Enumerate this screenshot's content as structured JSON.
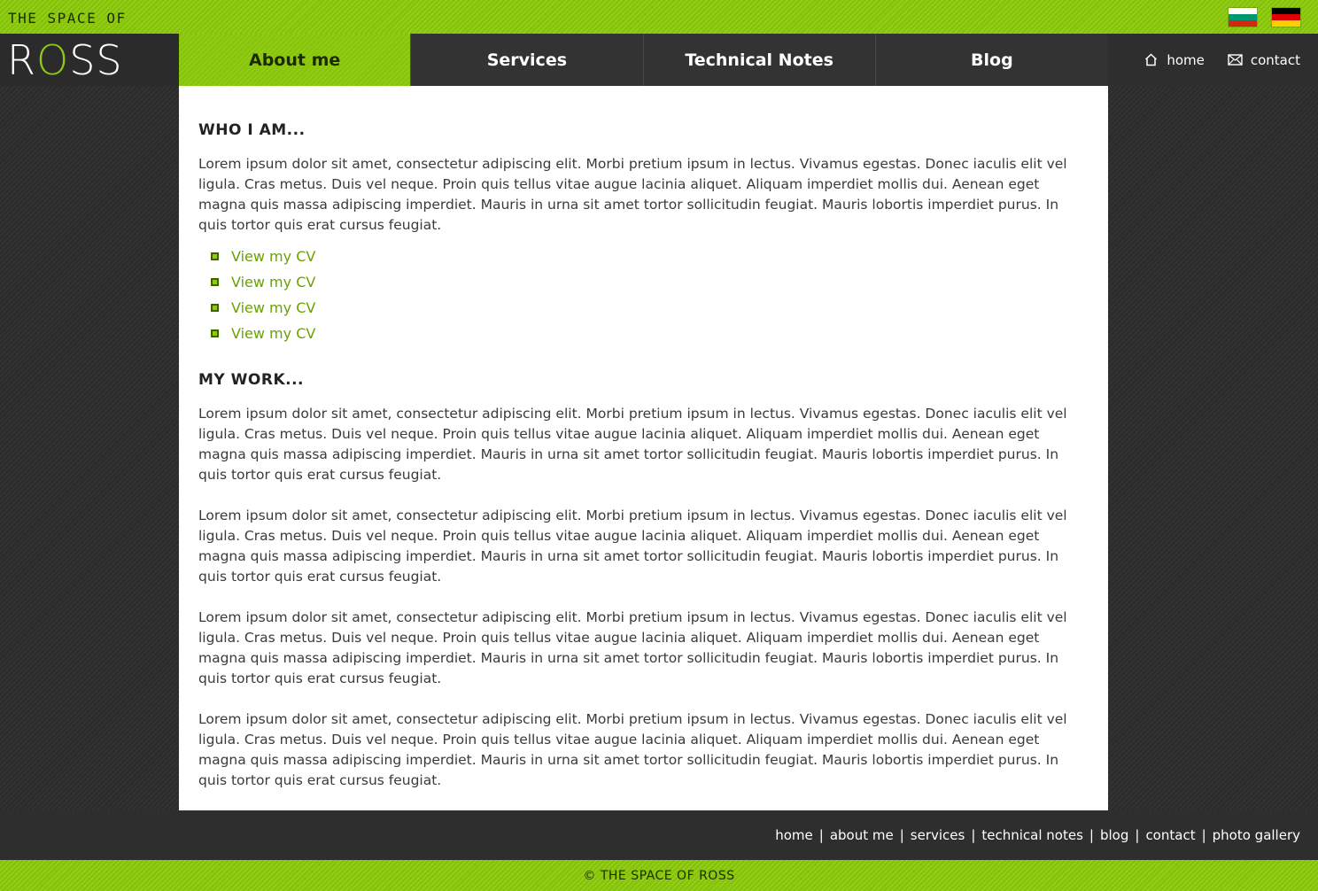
{
  "header": {
    "site_title": "THE SPACE OF",
    "logo": {
      "before": "R",
      "accent": "O",
      "after": "SS"
    },
    "flags": [
      {
        "name": "bulgaria-flag",
        "colors": [
          "#ffffff",
          "#00966e",
          "#d62612"
        ]
      },
      {
        "name": "germany-flag",
        "colors": [
          "#000000",
          "#dd0000",
          "#ffce00"
        ]
      }
    ]
  },
  "nav": {
    "tabs": [
      {
        "label": "About me",
        "active": true
      },
      {
        "label": "Services",
        "active": false
      },
      {
        "label": "Technical Notes",
        "active": false
      },
      {
        "label": "Blog",
        "active": false
      }
    ],
    "quick_links": {
      "home": "home",
      "contact": "contact"
    }
  },
  "content": {
    "section1_title": "WHO I AM...",
    "section1_text": "Lorem ipsum dolor sit amet, consectetur adipiscing elit. Morbi pretium ipsum in lectus. Vivamus egestas. Donec iaculis elit vel ligula. Cras metus. Duis vel neque. Proin quis tellus vitae augue lacinia aliquet. Aliquam imperdiet mollis dui. Aenean eget magna quis massa adipiscing imperdiet. Mauris in urna sit amet tortor sollicitudin feugiat. Mauris lobortis imperdiet purus. In quis tortor quis erat cursus feugiat.",
    "links": [
      "View my CV",
      "View my CV",
      "View my CV",
      "View my CV"
    ],
    "section2_title": "MY WORK...",
    "section2_paragraphs": [
      "Lorem ipsum dolor sit amet, consectetur adipiscing elit. Morbi pretium ipsum in lectus. Vivamus egestas. Donec iaculis elit vel ligula. Cras metus. Duis vel neque. Proin quis tellus vitae augue lacinia aliquet. Aliquam imperdiet mollis dui. Aenean eget magna quis massa adipiscing imperdiet. Mauris in urna sit amet tortor sollicitudin feugiat. Mauris lobortis imperdiet purus. In quis tortor quis erat cursus feugiat.",
      "Lorem ipsum dolor sit amet, consectetur adipiscing elit. Morbi pretium ipsum in lectus. Vivamus egestas. Donec iaculis elit vel ligula. Cras metus. Duis vel neque. Proin quis tellus vitae augue lacinia aliquet. Aliquam imperdiet mollis dui. Aenean eget magna quis massa adipiscing imperdiet. Mauris in urna sit amet tortor sollicitudin feugiat. Mauris lobortis imperdiet purus. In quis tortor quis erat cursus feugiat.",
      "Lorem ipsum dolor sit amet, consectetur adipiscing elit. Morbi pretium ipsum in lectus. Vivamus egestas. Donec iaculis elit vel ligula. Cras metus. Duis vel neque. Proin quis tellus vitae augue lacinia aliquet. Aliquam imperdiet mollis dui. Aenean eget magna quis massa adipiscing imperdiet. Mauris in urna sit amet tortor sollicitudin feugiat. Mauris lobortis imperdiet purus. In quis tortor quis erat cursus feugiat.",
      "Lorem ipsum dolor sit amet, consectetur adipiscing elit. Morbi pretium ipsum in lectus. Vivamus egestas. Donec iaculis elit vel ligula. Cras metus. Duis vel neque. Proin quis tellus vitae augue lacinia aliquet. Aliquam imperdiet mollis dui. Aenean eget magna quis massa adipiscing imperdiet. Mauris in urna sit amet tortor sollicitudin feugiat. Mauris lobortis imperdiet purus. In quis tortor quis erat cursus feugiat."
    ]
  },
  "footer": {
    "links": [
      "home",
      "about me",
      "services",
      "technical notes",
      "blog",
      "contact",
      "photo gallery"
    ],
    "separator": "|",
    "copyright": "© THE SPACE OF ROSS"
  },
  "colors": {
    "accent": "#8fcb12",
    "dark": "#2e2e2e",
    "link": "#6aa300"
  }
}
